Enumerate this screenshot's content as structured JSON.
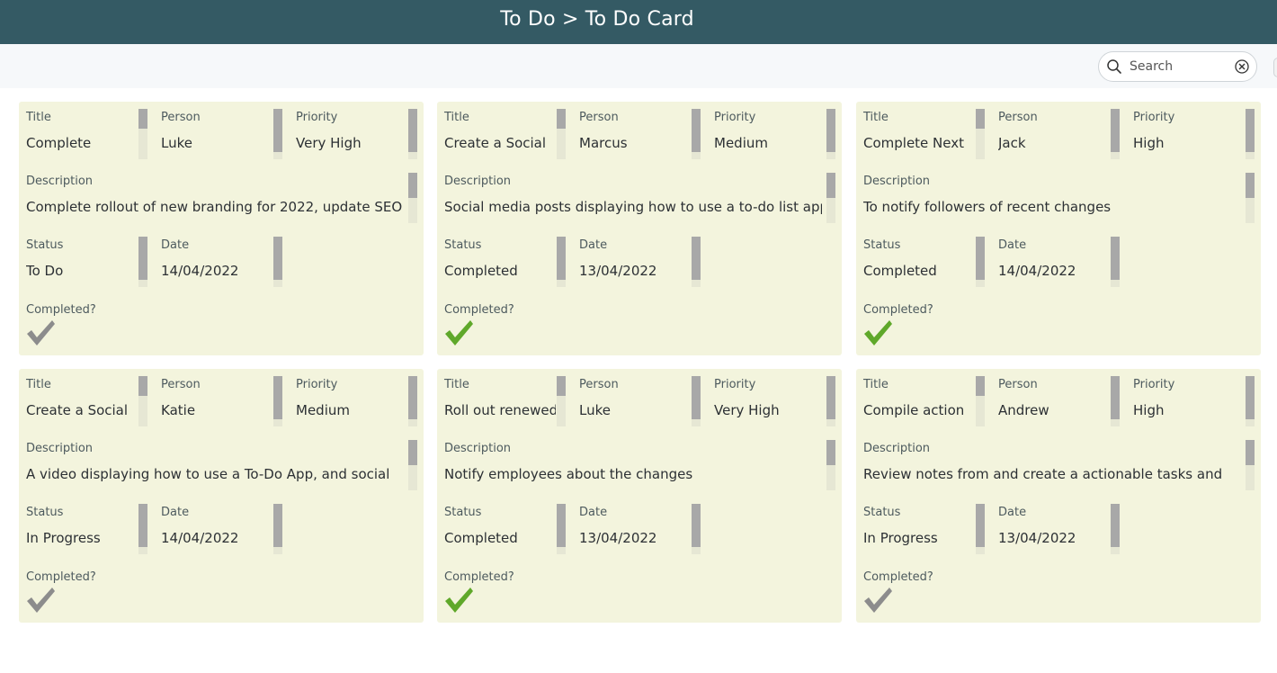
{
  "header": {
    "title": "To Do > To Do Card"
  },
  "search": {
    "placeholder": "Search"
  },
  "labels": {
    "title": "Title",
    "person": "Person",
    "priority": "Priority",
    "description": "Description",
    "status": "Status",
    "date": "Date",
    "completed": "Completed?"
  },
  "colors": {
    "header_bg": "#345a64",
    "card_bg": "#f3f4dd",
    "check_done": "#5fa82a",
    "check_todo": "#8c8c8c"
  },
  "cards": [
    {
      "title": "Complete",
      "person": "Luke",
      "priority": "Very High",
      "description": "Complete rollout of new branding for 2022, update SEO",
      "status": "To Do",
      "date": "14/04/2022",
      "completed": false
    },
    {
      "title": "Create a Social",
      "person": "Marcus",
      "priority": "Medium",
      "description": "Social media posts displaying how to use a to-do list app",
      "status": "Completed",
      "date": "13/04/2022",
      "completed": true
    },
    {
      "title": "Complete Next",
      "person": "Jack",
      "priority": "High",
      "description": "To notify followers of recent changes",
      "status": "Completed",
      "date": "14/04/2022",
      "completed": true
    },
    {
      "title": "Create a Social",
      "person": "Katie",
      "priority": "Medium",
      "description": "A video displaying how to use a To-Do App, and social",
      "status": "In Progress",
      "date": "14/04/2022",
      "completed": false
    },
    {
      "title": "Roll out renewed",
      "person": "Luke",
      "priority": "Very High",
      "description": "Notify employees about the changes",
      "status": "Completed",
      "date": "13/04/2022",
      "completed": true
    },
    {
      "title": "Compile action",
      "person": "Andrew",
      "priority": "High",
      "description": "Review notes from and create a actionable tasks and",
      "status": "In Progress",
      "date": "13/04/2022",
      "completed": false
    }
  ]
}
